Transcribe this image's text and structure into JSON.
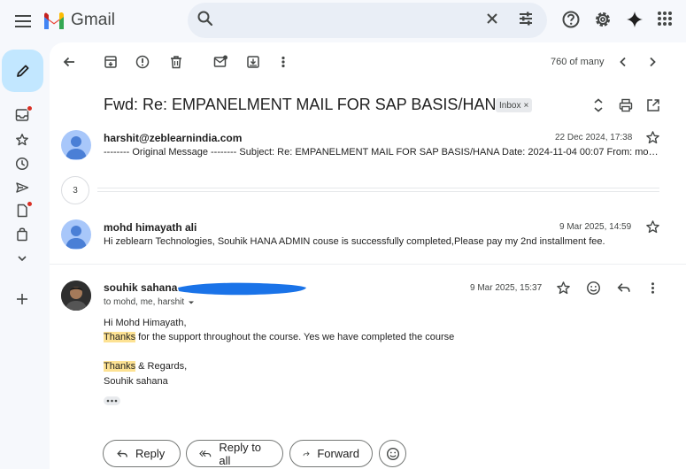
{
  "app": {
    "logo_text": "Gmail"
  },
  "search": {
    "placeholder": ""
  },
  "toolbar": {
    "pager": "760 of many"
  },
  "thread": {
    "subject": "Fwd: Re: EMPANELMENT MAIL FOR SAP BASIS/HANA",
    "label_chip": "Inbox",
    "label_chip_x": "×",
    "collapsed_count": "3"
  },
  "messages": [
    {
      "sender": "harshit@zeblearnindia.com",
      "snippet": "-------- Original Message -------- Subject: Re: EMPANELMENT MAIL FOR SAP BASIS/HANA Date: 2024-11-04 00:07 From: mohd himayath ali",
      "date": "22 Dec 2024, 17:38"
    },
    {
      "sender": "mohd himayath ali",
      "snippet": "Hi zeblearn Technologies, Souhik HANA ADMIN couse is successfully completed,Please pay my 2nd installment fee.",
      "date": "9 Mar 2025, 14:59"
    },
    {
      "sender": "souhik sahana",
      "recipients": "to mohd, me, harshit",
      "date": "9 Mar 2025, 15:37",
      "body": {
        "greeting": "Hi Mohd Himayath,",
        "line1_highlight": "Thanks",
        "line1_rest": " for the support throughout the course. Yes we have completed the course",
        "line2_highlight": "Thanks",
        "line2_rest": " & Regards,",
        "signature": "Souhik sahana"
      }
    }
  ],
  "actions": {
    "reply": "Reply",
    "reply_all": "Reply to all",
    "forward": "Forward"
  },
  "colors": {
    "compose_bg": "#c2e7ff",
    "highlight": "#fde293",
    "avatar_bg": "#a8c7fa",
    "redaction": "#1a73e8"
  }
}
